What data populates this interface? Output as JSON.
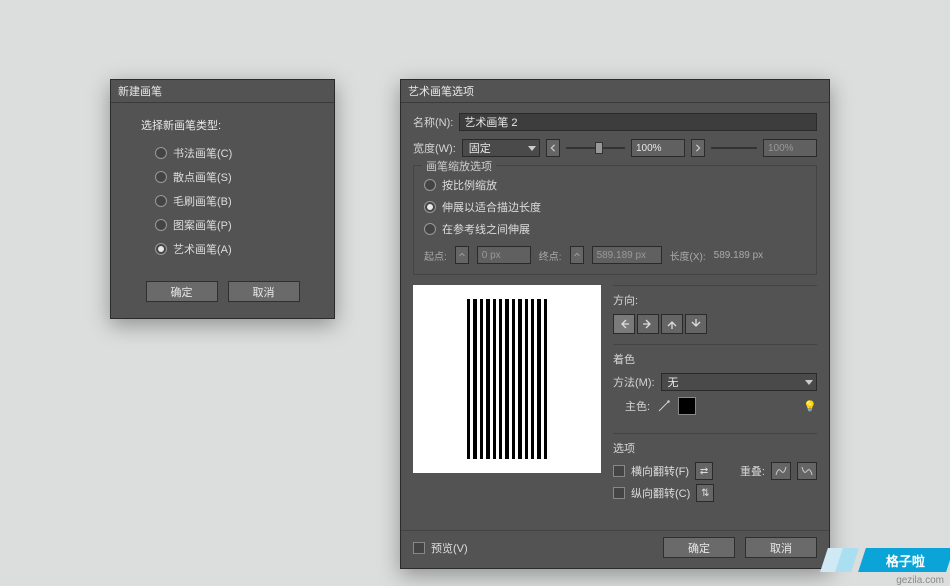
{
  "dialog1": {
    "title": "新建画笔",
    "heading": "选择新画笔类型:",
    "options": [
      {
        "label": "书法画笔(C)",
        "selected": false
      },
      {
        "label": "散点画笔(S)",
        "selected": false
      },
      {
        "label": "毛刷画笔(B)",
        "selected": false
      },
      {
        "label": "图案画笔(P)",
        "selected": false
      },
      {
        "label": "艺术画笔(A)",
        "selected": true
      }
    ],
    "ok": "确定",
    "cancel": "取消"
  },
  "dialog2": {
    "title": "艺术画笔选项",
    "nameLabel": "名称(N):",
    "nameValue": "艺术画笔 2",
    "widthLabel": "宽度(W):",
    "widthMode": "固定",
    "widthPctA": "100%",
    "widthPctB": "100%",
    "scaleGroup": {
      "label": "画笔缩放选项",
      "options": [
        {
          "label": "按比例缩放",
          "selected": false
        },
        {
          "label": "伸展以适合描边长度",
          "selected": true
        },
        {
          "label": "在参考线之间伸展",
          "selected": false
        }
      ],
      "startLabel": "起点:",
      "startValue": "0 px",
      "endLabel": "终点:",
      "endValue": "589.189 px",
      "lengthLabel": "长度(X):",
      "lengthValue": "589.189 px"
    },
    "direction": {
      "label": "方向:"
    },
    "colorize": {
      "label": "着色",
      "methodLabel": "方法(M):",
      "methodValue": "无",
      "keyColorLabel": "主色:"
    },
    "options": {
      "label": "选项",
      "flipH": "横向翻转(F)",
      "flipV": "纵向翻转(C)",
      "overlapLabel": "重叠:"
    },
    "previewLabel": "预览(V)",
    "ok": "确定",
    "cancel": "取消"
  },
  "watermark": {
    "text": "格子啦",
    "url": "gezila.com"
  }
}
